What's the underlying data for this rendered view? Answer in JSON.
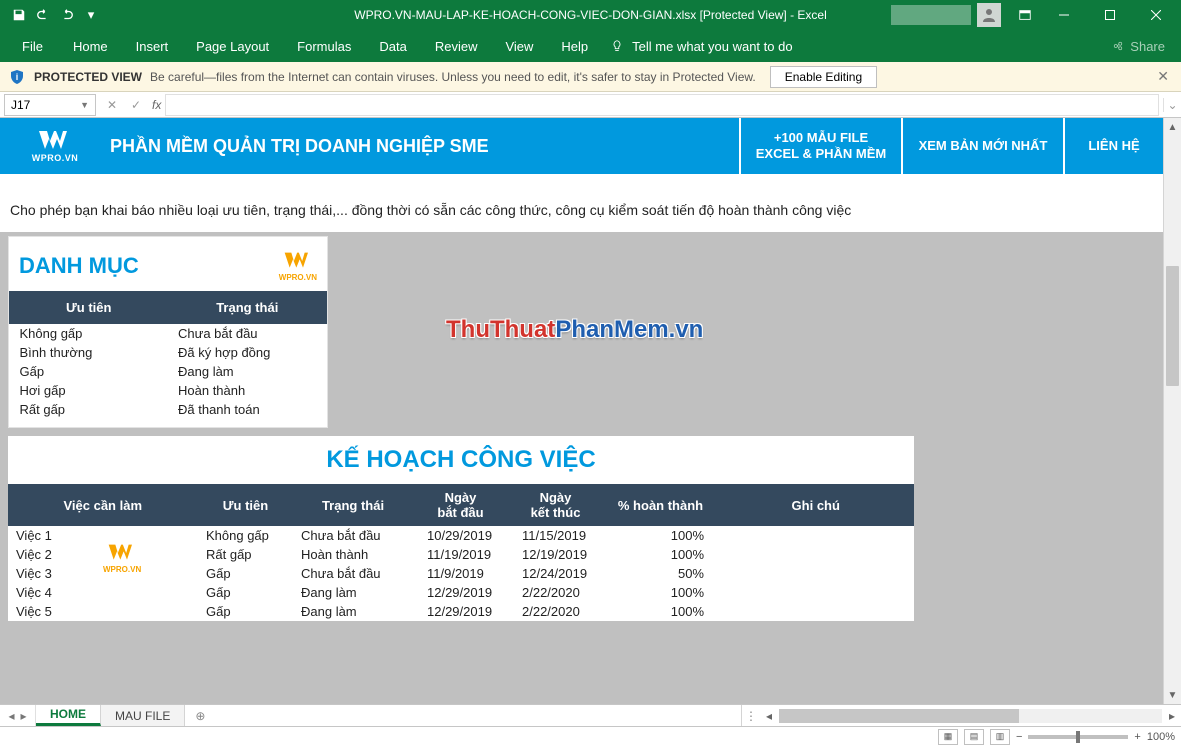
{
  "titlebar": {
    "title": "WPRO.VN-MAU-LAP-KE-HOACH-CONG-VIEC-DON-GIAN.xlsx  [Protected View]  -  Excel"
  },
  "ribbon": {
    "file": "File",
    "tabs": [
      "Home",
      "Insert",
      "Page Layout",
      "Formulas",
      "Data",
      "Review",
      "View",
      "Help"
    ],
    "tellme": "Tell me what you want to do",
    "share": "Share"
  },
  "protected": {
    "label": "PROTECTED VIEW",
    "msg": "Be careful—files from the Internet can contain viruses. Unless you need to edit, it's safer to stay in Protected View.",
    "btn": "Enable Editing"
  },
  "formula": {
    "name": "J17",
    "fx": "fx",
    "value": ""
  },
  "banner": {
    "logo_text": "WPRO.VN",
    "title": "PHẦN MỀM QUẢN TRỊ DOANH NGHIỆP SME",
    "b1_l1": "+100 MẪU FILE",
    "b1_l2": "EXCEL & PHẦN MỀM",
    "b2": "XEM BẢN MỚI NHẤT",
    "b3": "LIÊN HỆ"
  },
  "desc": "Cho phép bạn khai báo nhiều loại ưu tiên, trạng thái,... đồng thời có sẵn các công thức, công cụ kiểm soát tiến độ hoàn thành công việc",
  "danhmuc": {
    "title": "DANH MỤC",
    "brand": "WPRO.VN",
    "col1": "Ưu tiên",
    "col2": "Trạng thái",
    "rows": [
      {
        "c1": "Không gấp",
        "c2": "Chưa bắt đầu"
      },
      {
        "c1": "Bình thường",
        "c2": "Đã ký hợp đồng"
      },
      {
        "c1": "Gấp",
        "c2": "Đang làm"
      },
      {
        "c1": "Hơi gấp",
        "c2": "Hoàn thành"
      },
      {
        "c1": "Rất gấp",
        "c2": "Đã thanh toán"
      }
    ]
  },
  "kehoach": {
    "title": "KẾ HOẠCH CÔNG VIỆC",
    "brand": "WPRO.VN",
    "headers": [
      "Việc cần làm",
      "Ưu tiên",
      "Trạng thái",
      "Ngày bắt đầu",
      "Ngày kết thúc",
      "% hoàn thành",
      "Ghi chú"
    ],
    "rows": [
      {
        "viec": "Việc 1",
        "uutien": "Không gấp",
        "trangthai": "Chưa bắt đầu",
        "bd": "10/29/2019",
        "kt": "11/15/2019",
        "pct": "100%",
        "ghi": ""
      },
      {
        "viec": "Việc 2",
        "uutien": "Rất gấp",
        "trangthai": "Hoàn thành",
        "bd": "11/19/2019",
        "kt": "12/19/2019",
        "pct": "100%",
        "ghi": ""
      },
      {
        "viec": "Việc 3",
        "uutien": "Gấp",
        "trangthai": "Chưa bắt đầu",
        "bd": "11/9/2019",
        "kt": "12/24/2019",
        "pct": "50%",
        "ghi": ""
      },
      {
        "viec": "Việc 4",
        "uutien": "Gấp",
        "trangthai": "Đang làm",
        "bd": "12/29/2019",
        "kt": "2/22/2020",
        "pct": "100%",
        "ghi": ""
      },
      {
        "viec": "Việc 5",
        "uutien": "Gấp",
        "trangthai": "Đang làm",
        "bd": "12/29/2019",
        "kt": "2/22/2020",
        "pct": "100%",
        "ghi": ""
      }
    ]
  },
  "watermark": {
    "a": "ThuThuat",
    "b": "PhanMem.vn"
  },
  "tabs": {
    "active": "HOME",
    "other": "MAU FILE"
  },
  "status": {
    "zoom": "100%",
    "minus": "−",
    "plus": "+"
  }
}
